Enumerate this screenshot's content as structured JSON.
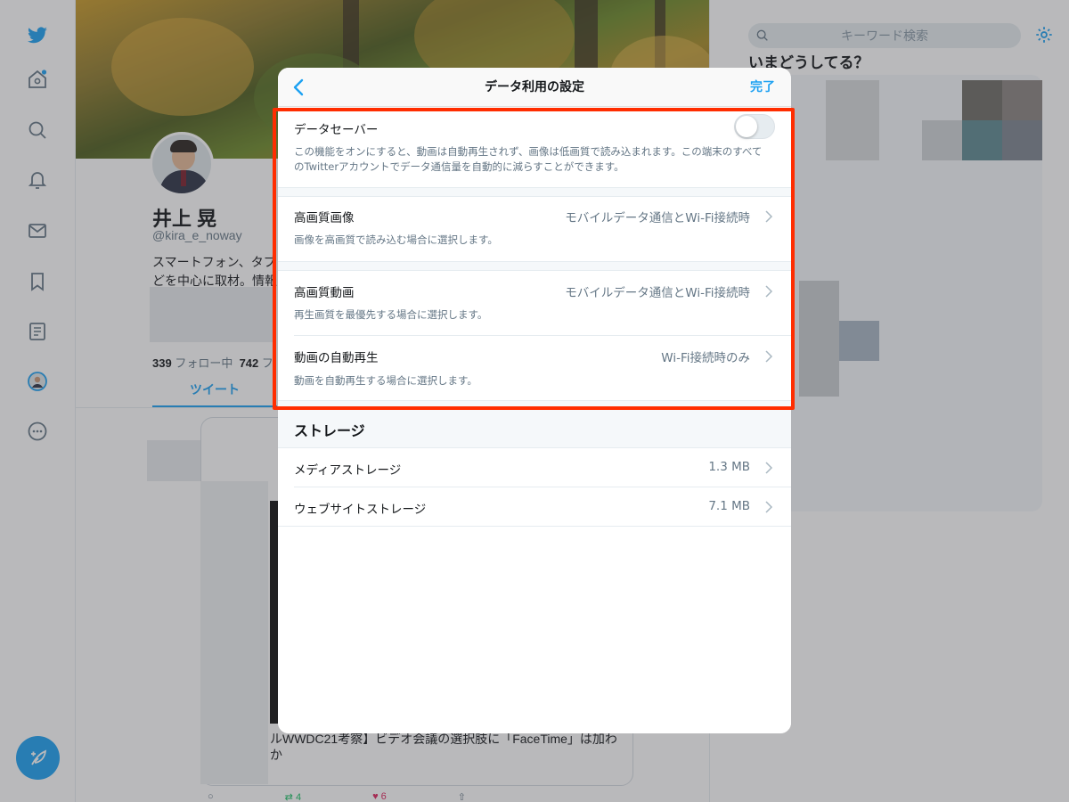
{
  "colors": {
    "accent": "#1da1f2",
    "highlight_border": "#ff2d00",
    "overlay": "rgba(60,60,67,0.36)"
  },
  "left_nav": {
    "items": [
      {
        "icon": "twitter-bird-icon"
      },
      {
        "icon": "home-icon"
      },
      {
        "icon": "search-icon"
      },
      {
        "icon": "bell-icon"
      },
      {
        "icon": "mail-icon"
      },
      {
        "icon": "bookmark-icon"
      },
      {
        "icon": "list-icon"
      },
      {
        "icon": "profile-avatar-icon"
      },
      {
        "icon": "more-icon"
      }
    ],
    "compose_icon": "compose-feather-icon"
  },
  "profile": {
    "name": "井上 晃",
    "handle": "@kira_e_noway",
    "bio_line1": "スマートフォン、タブ",
    "bio_line2": "どを中心に取材。情報",
    "following_count": "339",
    "following_label": "フォロー中",
    "followers_count": "742",
    "followers_label_partial": "フ",
    "tab_tweets": "ツイート",
    "tweet_snippet_line1": "ルWWDC21考察】ビデオ会議の選択肢に「FaceTime」は加わ",
    "tweet_snippet_line2": "か",
    "action_retweet_count": "4",
    "action_like_count": "6"
  },
  "right_column": {
    "search_placeholder": "キーワード検索",
    "trending_header": "いまどうしてる？"
  },
  "modal": {
    "title": "データ利用の設定",
    "done_label": "完了",
    "data_saver": {
      "title": "データセーバー",
      "toggle_on": false,
      "description": "この機能をオンにすると、動画は自動再生されず、画像は低画質で読み込まれます。この端末のすべてのTwitterアカウントでデータ通信量を自動的に減らすことができます。"
    },
    "hq_images": {
      "title": "高画質画像",
      "value": "モバイルデータ通信とWi-Fi接続時",
      "description": "画像を高画質で読み込む場合に選択します。"
    },
    "hq_video": {
      "title": "高画質動画",
      "value": "モバイルデータ通信とWi-Fi接続時",
      "description": "再生画質を最優先する場合に選択します。"
    },
    "autoplay": {
      "title": "動画の自動再生",
      "value": "Wi-Fi接続時のみ",
      "description": "動画を自動再生する場合に選択します。"
    },
    "storage": {
      "header": "ストレージ",
      "items": [
        {
          "label": "メディアストレージ",
          "value": "1.3 MB"
        },
        {
          "label": "ウェブサイトストレージ",
          "value": "7.1 MB"
        }
      ]
    }
  }
}
